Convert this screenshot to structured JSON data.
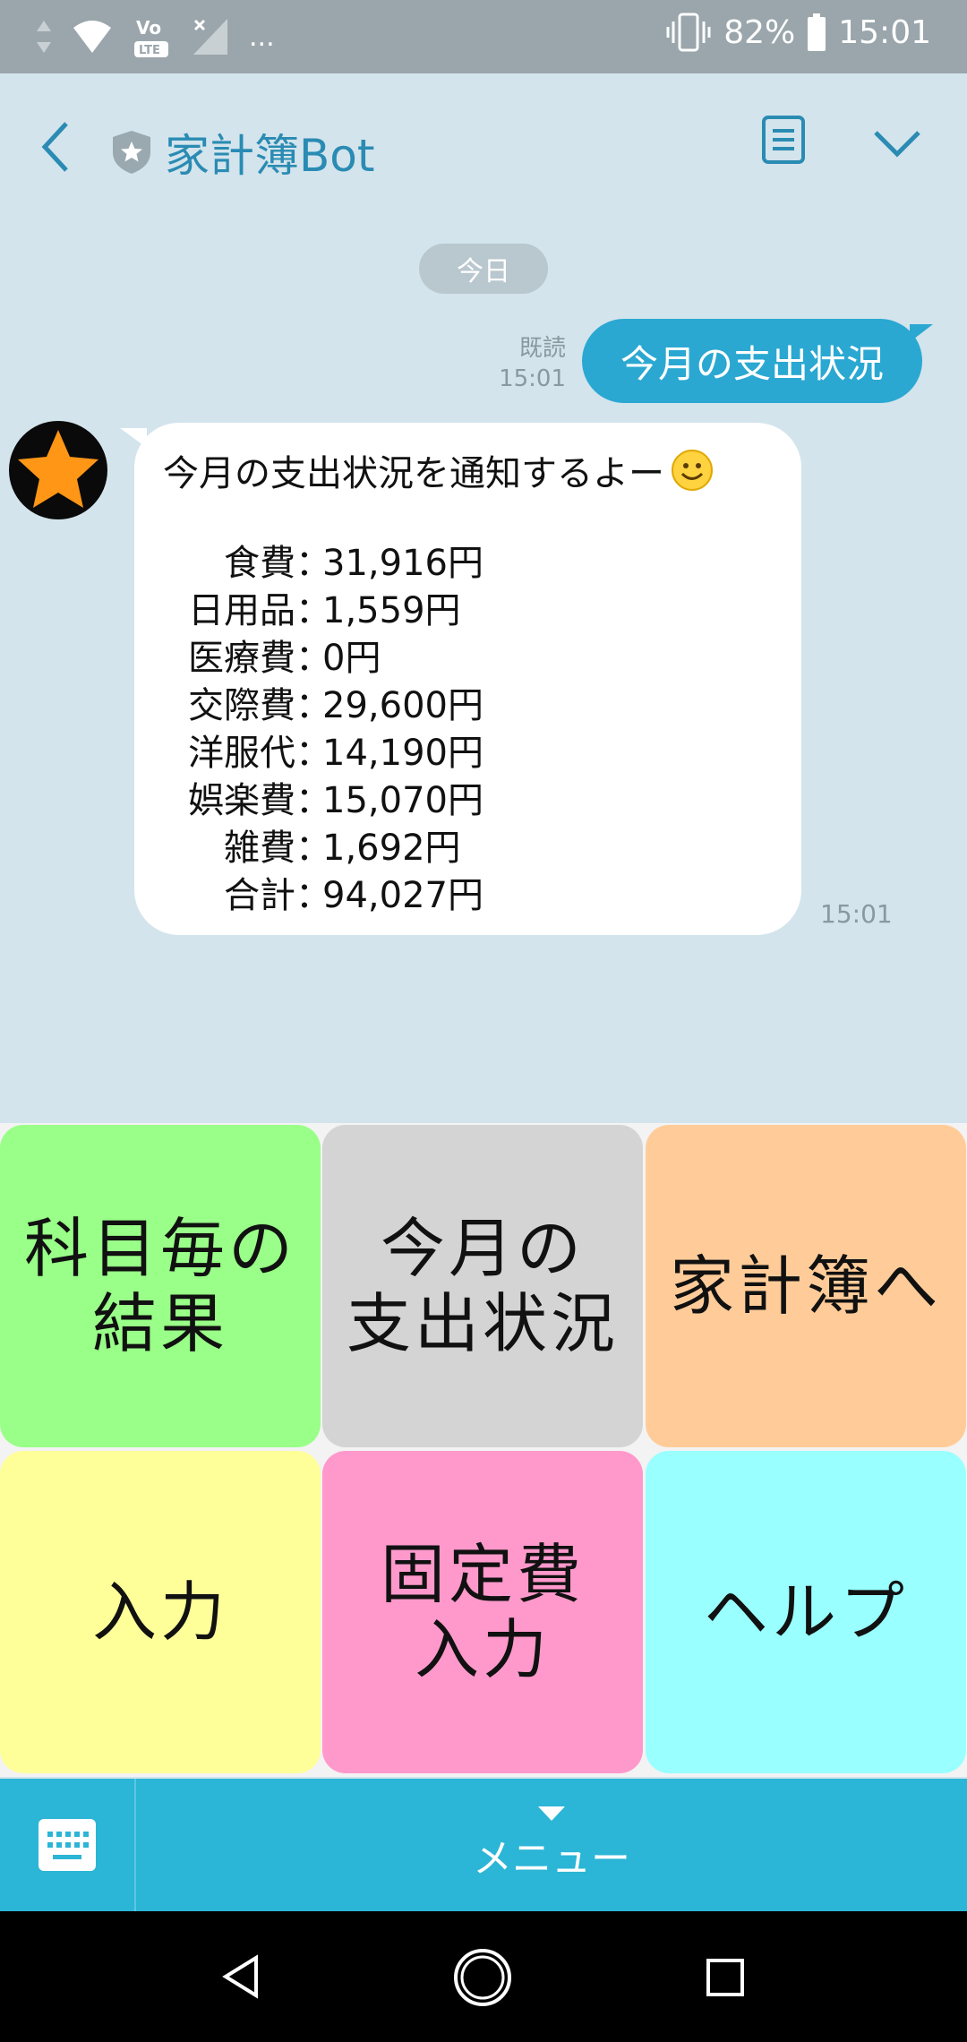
{
  "status_bar": {
    "battery": "82%",
    "time": "15:01",
    "overflow": "...",
    "lte_label": "LTE"
  },
  "header": {
    "title": "家計簿Bot"
  },
  "chat": {
    "date_separator": "今日",
    "user_message": {
      "text": "今月の支出状況",
      "read_label": "既読",
      "time": "15:01"
    },
    "bot_message": {
      "intro": "今月の支出状況を通知するよー",
      "rows": [
        {
          "label": "食費",
          "value": "31,916円"
        },
        {
          "label": "日用品",
          "value": "1,559円"
        },
        {
          "label": "医療費",
          "value": "0円"
        },
        {
          "label": "交際費",
          "value": "29,600円"
        },
        {
          "label": "洋服代",
          "value": "14,190円"
        },
        {
          "label": "娯楽費",
          "value": "15,070円"
        },
        {
          "label": "雑費",
          "value": "1,692円"
        },
        {
          "label": "合計",
          "value": "94,027円"
        }
      ],
      "separator": "：",
      "time": "15:01"
    }
  },
  "menu": {
    "tiles": [
      {
        "label": "科目毎の\n結果",
        "color": "#99ff88"
      },
      {
        "label": "今月の\n支出状況",
        "color": "#d4d4d4"
      },
      {
        "label": "家計簿へ",
        "color": "#ffcc99"
      },
      {
        "label": "入力",
        "color": "#ffff99"
      },
      {
        "label": "固定費\n入力",
        "color": "#ff99cc"
      },
      {
        "label": "ヘルプ",
        "color": "#99ffff"
      }
    ],
    "label": "メニュー"
  },
  "colors": {
    "accent": "#2aa8d2",
    "chat_bg": "#d3e4ec",
    "menu_bar": "#2bb5d6"
  }
}
